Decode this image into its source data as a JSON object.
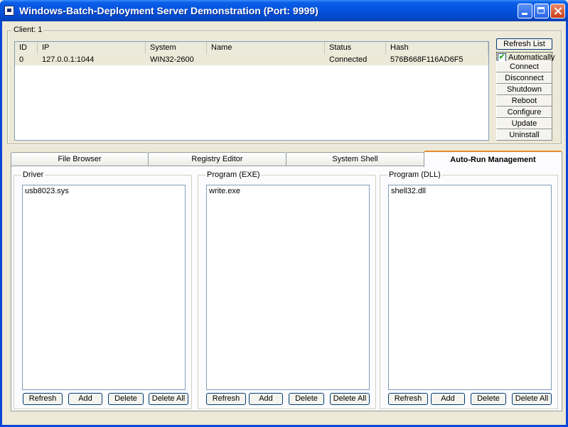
{
  "window": {
    "title": "Windows-Batch-Deployment Server Demonstration (Port: 9999)"
  },
  "clients": {
    "group_label": "Client: 1",
    "columns": [
      "ID",
      "IP",
      "System",
      "Name",
      "Status",
      "Hash"
    ],
    "rows": [
      {
        "id": "0",
        "ip": "127.0.0.1:1044",
        "system": "WIN32-2600",
        "name": "",
        "status": "Connected",
        "hash": "576B668F116AD6F5"
      }
    ]
  },
  "side_buttons": {
    "refresh_list": "Refresh List",
    "automatically": "Automatically",
    "automatically_checked": true,
    "connect": "Connect",
    "disconnect": "Disconnect",
    "shutdown": "Shutdown",
    "reboot": "Reboot",
    "configure": "Configure",
    "update": "Update",
    "uninstall": "Uninstall"
  },
  "tabs": [
    "File Browser",
    "Registry Editor",
    "System Shell",
    "Auto-Run Management"
  ],
  "active_tab": "Auto-Run Management",
  "panels": [
    {
      "label": "Driver",
      "items": [
        "usb8023.sys"
      ]
    },
    {
      "label": "Program (EXE)",
      "items": [
        "write.exe"
      ]
    },
    {
      "label": "Program (DLL)",
      "items": [
        "shell32.dll"
      ]
    }
  ],
  "panel_buttons": {
    "refresh": "Refresh",
    "add": "Add",
    "delete": "Delete",
    "delete_all": "Delete All"
  }
}
